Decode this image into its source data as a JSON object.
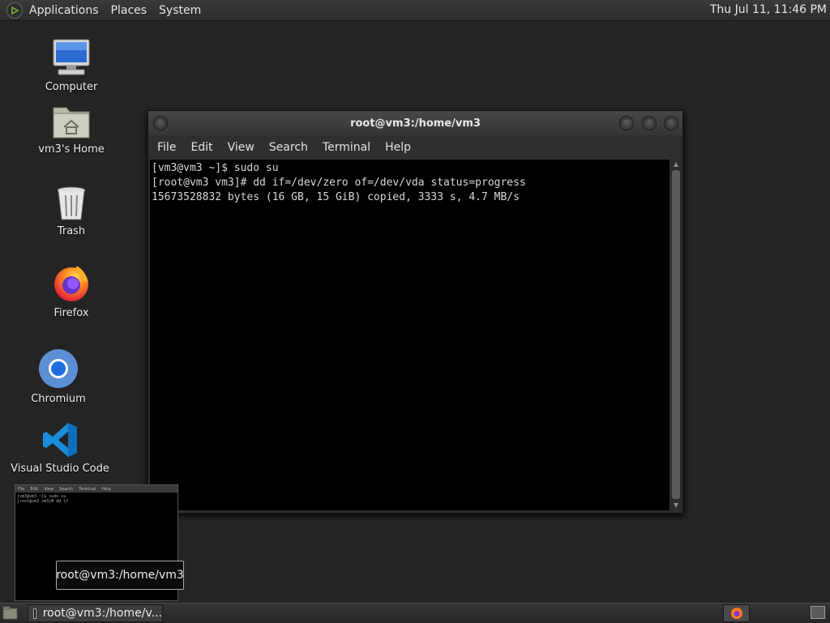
{
  "top_panel": {
    "menus": [
      "Applications",
      "Places",
      "System"
    ],
    "clock": "Thu Jul 11, 11:46 PM"
  },
  "desktop_icons": [
    {
      "label": "Computer",
      "icon": "computer-icon"
    },
    {
      "label": "vm3's Home",
      "icon": "home-folder-icon"
    },
    {
      "label": "Trash",
      "icon": "trash-icon"
    },
    {
      "label": "Firefox",
      "icon": "firefox-icon"
    },
    {
      "label": "Chromium",
      "icon": "chromium-icon"
    },
    {
      "label": "Visual Studio Code",
      "icon": "vscode-icon"
    }
  ],
  "terminal": {
    "title": "root@vm3:/home/vm3",
    "menu": [
      "File",
      "Edit",
      "View",
      "Search",
      "Terminal",
      "Help"
    ],
    "lines": [
      "[vm3@vm3 ~]$ sudo su",
      "[root@vm3 vm3]# dd if=/dev/zero of=/dev/vda status=progress",
      "15673528832 bytes (16 GB, 15 GiB) copied, 3333 s, 4.7 MB/s"
    ]
  },
  "preview": {
    "menu": [
      "File",
      "Edit",
      "View",
      "Search",
      "Terminal",
      "Help"
    ],
    "lines": [
      "[vm3@vm3 ~]$ sudo su",
      "[root@vm3 vm3]# dd if"
    ]
  },
  "tooltip": "root@vm3:/home/vm3",
  "bottom_panel": {
    "task_label": "root@vm3:/home/v..."
  }
}
